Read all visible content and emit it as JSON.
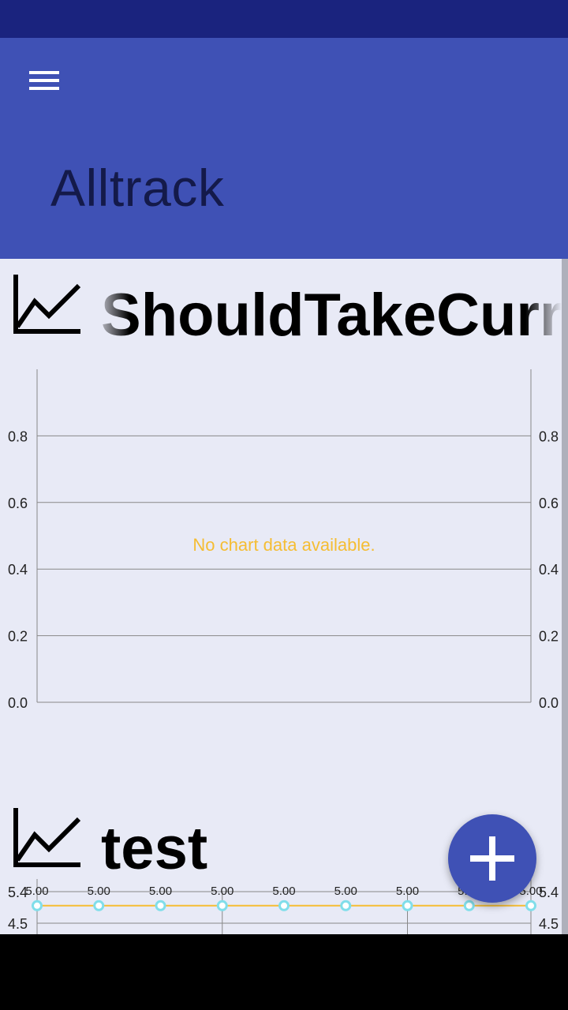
{
  "app": {
    "title": "Alltrack",
    "colors": {
      "status_bar": "#1a237e",
      "app_bar": "#3f51b5",
      "content_bg": "#e8eaf6",
      "line": "#f5bd33",
      "point": "#80deea"
    }
  },
  "toolbar": {
    "menu_icon": "hamburger-menu-icon"
  },
  "cards": [
    {
      "title": "ShouldTakeCurrent",
      "icon": "line-chart-icon",
      "chart_data": {
        "type": "line",
        "series": [],
        "empty_message": "No chart data available.",
        "y_ticks": [
          "0.0",
          "0.2",
          "0.4",
          "0.6",
          "0.8"
        ],
        "ylim": [
          0,
          1
        ],
        "dual_y_axis": true,
        "grid": true
      }
    },
    {
      "title": "test",
      "icon": "line-chart-icon",
      "chart_data": {
        "type": "line",
        "series": [
          {
            "values": [
              5,
              5,
              5,
              5,
              5,
              5,
              5,
              5,
              5
            ],
            "labels": [
              "5.00",
              "5.00",
              "5.00",
              "5.00",
              "5.00",
              "5.00",
              "5.00",
              "5.00",
              "5.00"
            ]
          }
        ],
        "y_ticks": [
          "5.4",
          "4.5"
        ],
        "dual_y_axis": true,
        "grid": true
      }
    }
  ],
  "fab": {
    "icon": "plus-icon"
  }
}
